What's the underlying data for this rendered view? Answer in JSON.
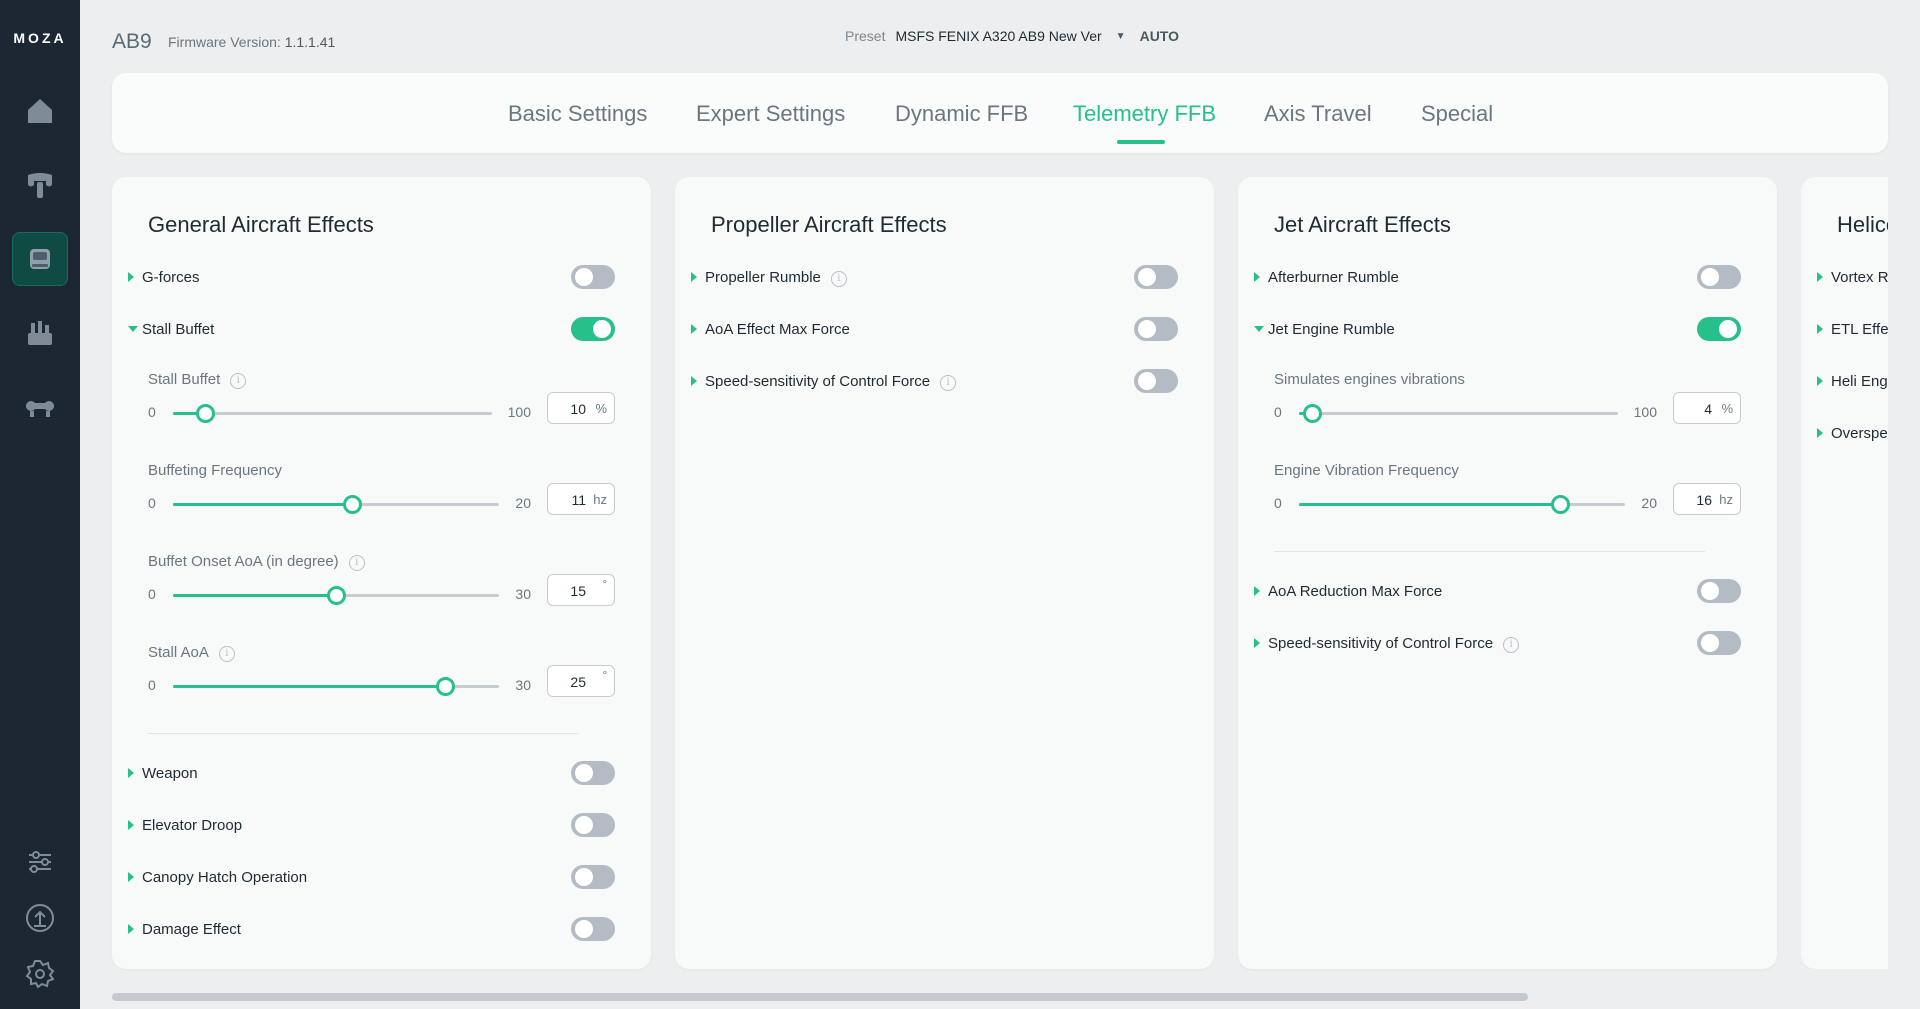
{
  "brand": {
    "logo": "MOZA"
  },
  "sidebar": {
    "items": [
      {
        "icon": "home-icon",
        "active": false
      },
      {
        "icon": "flight-yoke-icon",
        "active": false
      },
      {
        "icon": "joystick-base-icon",
        "active": true
      },
      {
        "icon": "throttle-quadrant-icon",
        "active": false
      },
      {
        "icon": "rudder-pedals-icon",
        "active": false
      }
    ],
    "bottom": [
      {
        "icon": "sliders-icon"
      },
      {
        "icon": "firmware-update-icon"
      },
      {
        "icon": "gear-icon"
      }
    ]
  },
  "header": {
    "device": "AB9",
    "firmware_label": "Firmware Version:",
    "firmware_value": "1.1.1.41",
    "preset_label": "Preset",
    "preset_value": "MSFS FENIX A320 AB9 New Ver",
    "preset_mode": "AUTO"
  },
  "tabs": {
    "items": [
      {
        "label": "Basic Settings"
      },
      {
        "label": "Expert Settings"
      },
      {
        "label": "Dynamic FFB"
      },
      {
        "label": "Telemetry FFB"
      },
      {
        "label": "Axis Travel"
      },
      {
        "label": "Special"
      }
    ],
    "active": "Telemetry FFB"
  },
  "panels": {
    "general": {
      "title": "General Aircraft Effects",
      "rows": [
        {
          "label": "G-forces",
          "on": false
        },
        {
          "label": "Stall Buffet",
          "on": true
        },
        {
          "label": "Weapon",
          "on": false
        },
        {
          "label": "Elevator Droop",
          "on": false
        },
        {
          "label": "Canopy Hatch Operation",
          "on": false
        },
        {
          "label": "Damage Effect",
          "on": false
        }
      ],
      "sliders": [
        {
          "label": "Stall Buffet",
          "min": "0",
          "max": "100",
          "value": "10",
          "unit": "%",
          "fraction": 0.1
        },
        {
          "label": "Buffeting Frequency",
          "min": "0",
          "max": "20",
          "value": "11",
          "unit": "hz",
          "fraction": 0.55
        },
        {
          "label": "Buffet Onset AoA (in degree)",
          "min": "0",
          "max": "30",
          "value": "15",
          "unit": "°",
          "fraction": 0.5
        },
        {
          "label": "Stall AoA",
          "min": "0",
          "max": "30",
          "value": "25",
          "unit": "°",
          "fraction": 0.8333
        }
      ]
    },
    "propeller": {
      "title": "Propeller Aircraft Effects",
      "rows": [
        {
          "label": "Propeller Rumble",
          "on": false
        },
        {
          "label": "AoA Effect Max Force",
          "on": false
        },
        {
          "label": "Speed-sensitivity of Control Force",
          "on": false
        }
      ]
    },
    "jet": {
      "title": "Jet Aircraft Effects",
      "rows": [
        {
          "label": "Afterburner Rumble",
          "on": false
        },
        {
          "label": "Jet Engine Rumble",
          "on": true
        },
        {
          "label": "AoA Reduction Max Force",
          "on": false
        },
        {
          "label": "Speed-sensitivity of Control Force",
          "on": false
        }
      ],
      "sliders": [
        {
          "label": "Simulates engines vibrations",
          "min": "0",
          "max": "100",
          "value": "4",
          "unit": "%",
          "fraction": 0.04
        },
        {
          "label": "Engine Vibration Frequency",
          "min": "0",
          "max": "20",
          "value": "16",
          "unit": "hz",
          "fraction": 0.8
        }
      ]
    },
    "helicopter": {
      "title": "Helicopter Aircraft Effects",
      "rows": [
        {
          "label": "Vortex Ring"
        },
        {
          "label": "ETL Effect"
        },
        {
          "label": "Heli Engine"
        },
        {
          "label": "Overspeed"
        }
      ]
    }
  },
  "colors": {
    "accent": "#28c08a",
    "sidebar_bg": "#1c2733",
    "toggle_off": "#b3bcc4"
  }
}
